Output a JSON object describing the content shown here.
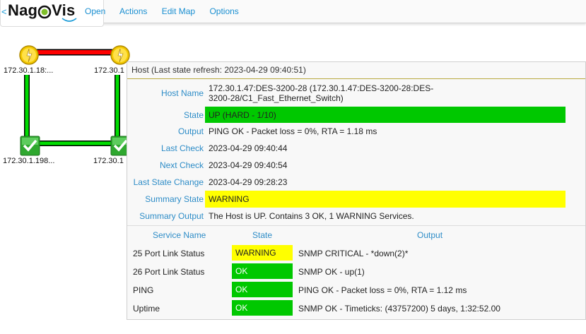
{
  "header": {
    "back_label": "<",
    "logo_prefix": "Nag",
    "logo_suffix": "Vis",
    "menu": [
      "Open",
      "Actions",
      "Edit Map",
      "Options"
    ]
  },
  "map": {
    "nodes": [
      {
        "label": "172.30.1.18:...",
        "state": "warning"
      },
      {
        "label": "172.30.1",
        "state": "warning"
      },
      {
        "label": "172.30.1.198...",
        "state": "ok"
      },
      {
        "label": "172.30.1",
        "state": "ok"
      }
    ]
  },
  "panel": {
    "title": "Host (Last state refresh: 2023-04-29 09:40:51)",
    "fields": {
      "host_name": {
        "label": "Host Name",
        "value_line1": "172.30.1.47:DES-3200-28 (172.30.1.47:DES-3200-28:DES-",
        "value_line2": "3200-28/C1_Fast_Ethernet_Switch)"
      },
      "state": {
        "label": "State",
        "value": "UP (HARD - 1/10)"
      },
      "output": {
        "label": "Output",
        "value": "PING OK - Packet loss = 0%, RTA = 1.18 ms"
      },
      "last_check": {
        "label": "Last Check",
        "value": "2023-04-29 09:40:44"
      },
      "next_check": {
        "label": "Next Check",
        "value": "2023-04-29 09:40:54"
      },
      "last_state_change": {
        "label": "Last State Change",
        "value": "2023-04-29 09:28:23"
      },
      "summary_state": {
        "label": "Summary State",
        "value": "WARNING"
      },
      "summary_output": {
        "label": "Summary Output",
        "value": "The Host is UP. Contains 3 OK, 1 WARNING Services."
      }
    },
    "services": {
      "headers": {
        "name": "Service Name",
        "state": "State",
        "output": "Output"
      },
      "rows": [
        {
          "name": "25 Port Link Status",
          "state": "WARNING",
          "output": "SNMP CRITICAL - *down(2)*"
        },
        {
          "name": "26 Port Link Status",
          "state": "OK",
          "output": "SNMP OK - up(1)"
        },
        {
          "name": "PING",
          "state": "OK",
          "output": "PING OK - Packet loss = 0%, RTA = 1.12 ms"
        },
        {
          "name": "Uptime",
          "state": "OK",
          "output": "SNMP OK - Timeticks: (43757200) 5 days, 1:32:52.00"
        }
      ]
    }
  },
  "colors": {
    "accent": "#1a8fd1",
    "ok": "#00c800",
    "warning": "#ffff00",
    "link_down": "#ff0000",
    "link_up": "#00dd00"
  }
}
